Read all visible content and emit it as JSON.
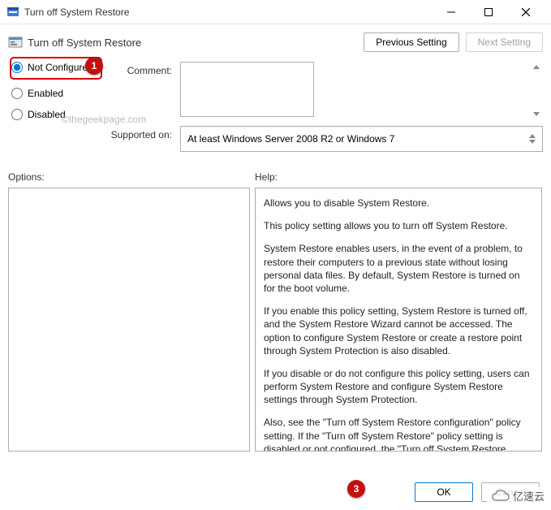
{
  "window": {
    "title": "Turn off System Restore"
  },
  "header": {
    "title": "Turn off System Restore",
    "previous_setting": "Previous Setting",
    "next_setting": "Next Setting"
  },
  "radios": {
    "not_configured": "Not Configured",
    "enabled": "Enabled",
    "disabled": "Disabled",
    "selected": "not_configured"
  },
  "labels": {
    "comment": "Comment:",
    "supported_on": "Supported on:",
    "options": "Options:",
    "help": "Help:"
  },
  "fields": {
    "comment_value": "",
    "supported_text": "At least Windows Server 2008 R2 or Windows 7"
  },
  "help_text": {
    "p1": "Allows you to disable System Restore.",
    "p2": "This policy setting allows you to turn off System Restore.",
    "p3": "System Restore enables users, in the event of a problem, to restore their computers to a previous state without losing personal data files. By default, System Restore is turned on for the boot volume.",
    "p4": "If you enable this policy setting, System Restore is turned off, and the System Restore Wizard cannot be accessed. The option to configure System Restore or create a restore point through System Protection is also disabled.",
    "p5": "If you disable or do not configure this policy setting, users can perform System Restore and configure System Restore settings through System Protection.",
    "p6": "Also, see the \"Turn off System Restore configuration\" policy setting. If the \"Turn off System Restore\" policy setting is disabled or not configured, the \"Turn off System Restore configuration\""
  },
  "buttons": {
    "ok": "OK",
    "cancel": "Cancel"
  },
  "annotations": {
    "callout1": "1",
    "callout3": "3"
  },
  "watermark": "©thegeekpage.com",
  "logo_text": "亿速云"
}
